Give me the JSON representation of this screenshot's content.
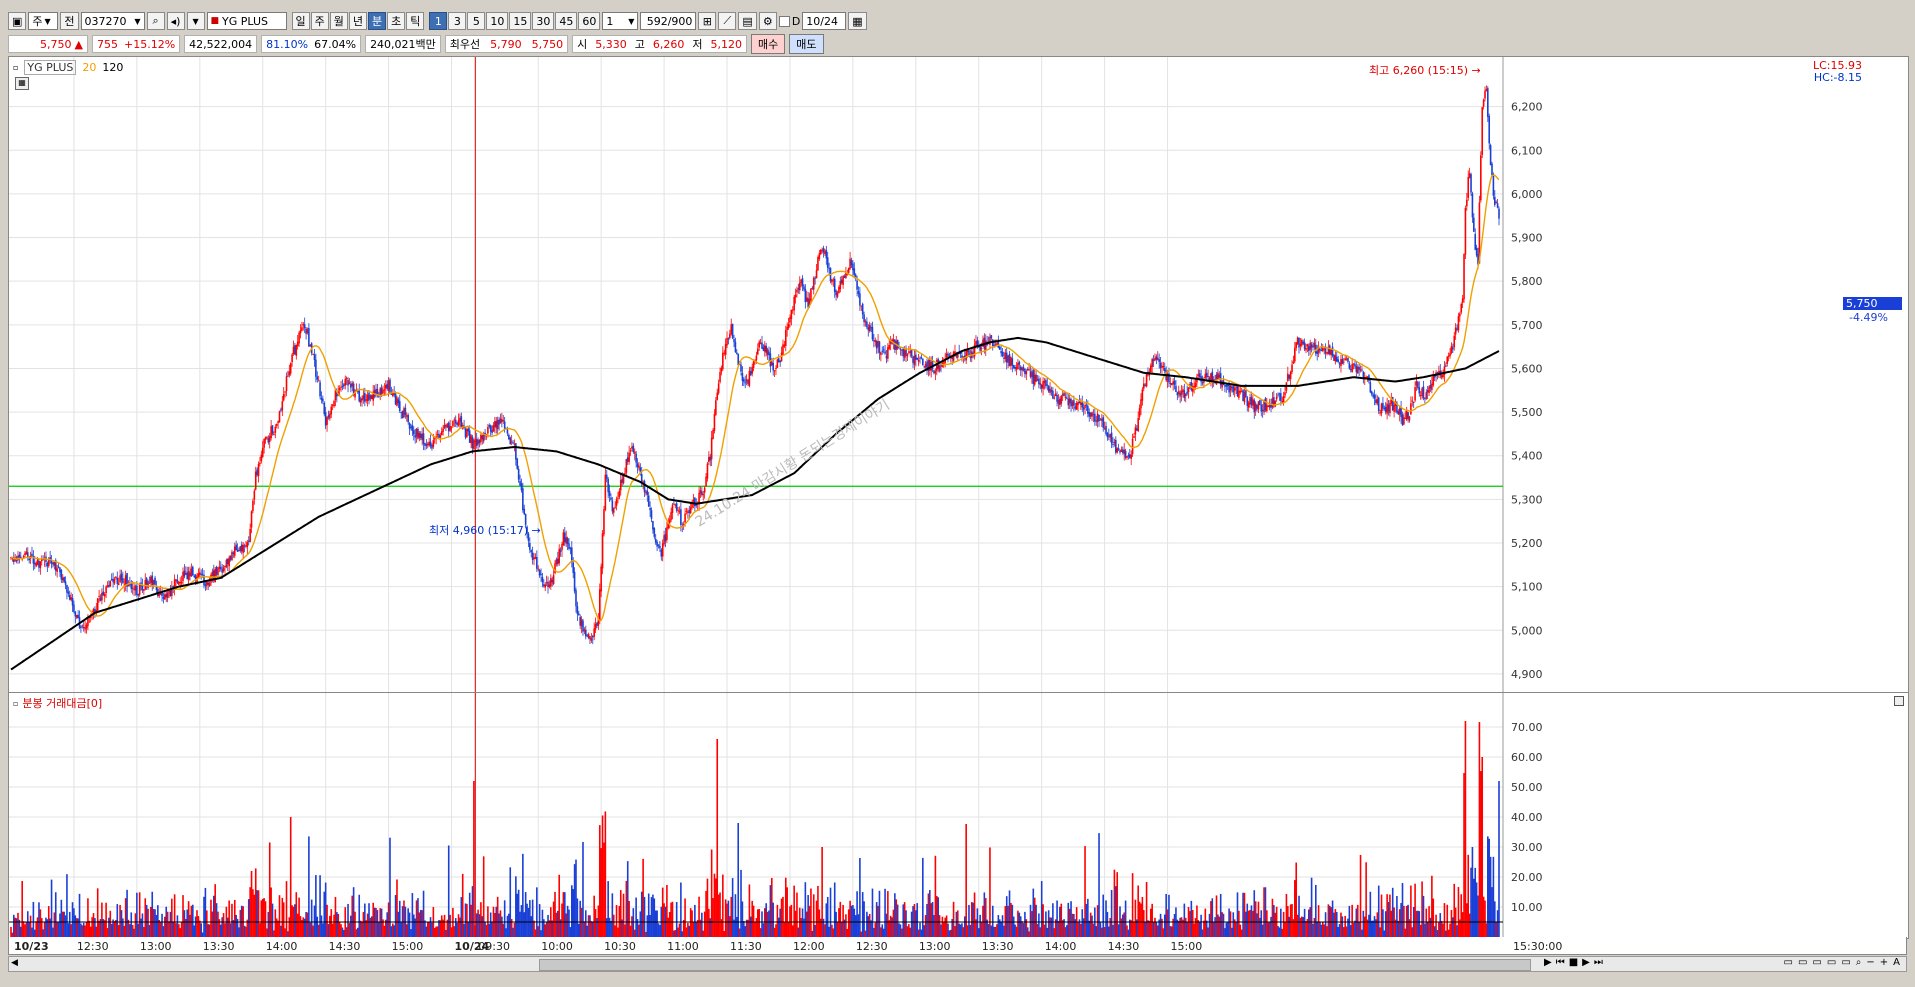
{
  "toolbar": {
    "period_type": "주",
    "prefix": "전",
    "code": "037270",
    "stock_name": "YG PLUS",
    "periods": [
      "일",
      "주",
      "월",
      "년",
      "분",
      "초",
      "틱"
    ],
    "period_selected": "분",
    "intervals": [
      "1",
      "3",
      "5",
      "10",
      "15",
      "30",
      "45",
      "60"
    ],
    "interval_selected": "1",
    "count_select": "1",
    "count_display": "592/900",
    "checkbox_label": "D",
    "date": "10/24"
  },
  "quote": {
    "price": "5,750",
    "change": "755",
    "change_pct": "+15.12%",
    "volume": "42,522,004",
    "ratio1": "81.10%",
    "ratio2": "67.04%",
    "amount": "240,021백만",
    "best_label": "최우선",
    "best_sell": "5,790",
    "best_buy": "5,750",
    "open_label": "시",
    "open": "5,330",
    "high_label": "고",
    "high": "6,260",
    "low_label": "저",
    "low": "5,120",
    "buy_btn": "매수",
    "sell_btn": "매도"
  },
  "chart_header": {
    "name": "YG PLUS",
    "ma_short": "20",
    "ma_long": "120",
    "lc": "LC:15.93",
    "hc": "HC:-8.15",
    "current_price": "5,750",
    "current_pct": "-4.49%",
    "high_annot": "최고 6,260 (15:15)",
    "low_annot": "최저 4,960 (15:17)",
    "watermark": "24.10.24 마감시황 돈되는경제이야기"
  },
  "volume_header": {
    "title": "분봉 거래대금[0]"
  },
  "colors": {
    "up": "#ff0000",
    "down": "#1a3fd6",
    "ma20": "#f0a000",
    "ma120": "#000000",
    "hline": "#00cc00"
  },
  "chart_data": {
    "type": "candlestick",
    "y_ticks": [
      "6,200",
      "6,100",
      "6,000",
      "5,900",
      "5,800",
      "5,700",
      "5,600",
      "5,500",
      "5,400",
      "5,300",
      "5,200",
      "5,100",
      "5,000",
      "4,900"
    ],
    "ylim": [
      4870,
      6300
    ],
    "horizontal_line": 5330,
    "vol_ticks": [
      "70.00",
      "60.00",
      "50.00",
      "40.00",
      "30.00",
      "20.00",
      "10.00"
    ],
    "vol_ylim": [
      0,
      78
    ],
    "x_labels": [
      "10/23",
      "12:30",
      "13:00",
      "13:30",
      "14:00",
      "14:30",
      "15:00",
      "10/24",
      "09:30",
      "10:00",
      "10:30",
      "11:00",
      "11:30",
      "12:00",
      "12:30",
      "13:00",
      "13:30",
      "14:00",
      "14:30",
      "15:00",
      "15:30:00"
    ],
    "price_anchors": [
      [
        0,
        5160
      ],
      [
        10,
        5180
      ],
      [
        20,
        5150
      ],
      [
        30,
        5160
      ],
      [
        40,
        5100
      ],
      [
        50,
        5000
      ],
      [
        60,
        5050
      ],
      [
        70,
        5110
      ],
      [
        80,
        5120
      ],
      [
        90,
        5090
      ],
      [
        100,
        5110
      ],
      [
        110,
        5070
      ],
      [
        120,
        5120
      ],
      [
        130,
        5130
      ],
      [
        140,
        5110
      ],
      [
        150,
        5140
      ],
      [
        160,
        5180
      ],
      [
        170,
        5200
      ],
      [
        175,
        5350
      ],
      [
        180,
        5420
      ],
      [
        185,
        5450
      ],
      [
        190,
        5470
      ],
      [
        200,
        5620
      ],
      [
        210,
        5700
      ],
      [
        215,
        5640
      ],
      [
        220,
        5560
      ],
      [
        225,
        5480
      ],
      [
        230,
        5530
      ],
      [
        240,
        5570
      ],
      [
        250,
        5530
      ],
      [
        260,
        5540
      ],
      [
        270,
        5560
      ],
      [
        280,
        5500
      ],
      [
        290,
        5450
      ],
      [
        300,
        5420
      ],
      [
        310,
        5460
      ],
      [
        320,
        5480
      ],
      [
        330,
        5430
      ],
      [
        340,
        5450
      ],
      [
        350,
        5480
      ],
      [
        360,
        5420
      ],
      [
        370,
        5200
      ],
      [
        380,
        5110
      ],
      [
        385,
        5100
      ],
      [
        390,
        5150
      ],
      [
        395,
        5220
      ],
      [
        400,
        5180
      ],
      [
        405,
        5030
      ],
      [
        410,
        5000
      ],
      [
        415,
        4990
      ],
      [
        420,
        5020
      ],
      [
        425,
        5350
      ],
      [
        430,
        5280
      ],
      [
        435,
        5320
      ],
      [
        440,
        5380
      ],
      [
        445,
        5420
      ],
      [
        450,
        5360
      ],
      [
        455,
        5300
      ],
      [
        460,
        5220
      ],
      [
        465,
        5180
      ],
      [
        470,
        5240
      ],
      [
        475,
        5300
      ],
      [
        480,
        5240
      ],
      [
        485,
        5280
      ],
      [
        490,
        5300
      ],
      [
        495,
        5320
      ],
      [
        500,
        5400
      ],
      [
        505,
        5550
      ],
      [
        510,
        5650
      ],
      [
        515,
        5690
      ],
      [
        520,
        5620
      ],
      [
        525,
        5560
      ],
      [
        530,
        5600
      ],
      [
        535,
        5660
      ],
      [
        540,
        5640
      ],
      [
        545,
        5600
      ],
      [
        550,
        5620
      ],
      [
        555,
        5700
      ],
      [
        560,
        5760
      ],
      [
        565,
        5800
      ],
      [
        570,
        5740
      ],
      [
        575,
        5820
      ],
      [
        580,
        5880
      ],
      [
        585,
        5820
      ],
      [
        590,
        5780
      ],
      [
        595,
        5800
      ],
      [
        600,
        5840
      ],
      [
        605,
        5780
      ],
      [
        610,
        5720
      ],
      [
        615,
        5680
      ],
      [
        620,
        5650
      ],
      [
        625,
        5630
      ],
      [
        630,
        5660
      ],
      [
        640,
        5630
      ],
      [
        650,
        5620
      ],
      [
        660,
        5600
      ],
      [
        670,
        5640
      ],
      [
        680,
        5620
      ],
      [
        690,
        5650
      ],
      [
        700,
        5660
      ],
      [
        710,
        5630
      ],
      [
        720,
        5600
      ],
      [
        730,
        5580
      ],
      [
        740,
        5560
      ],
      [
        750,
        5530
      ],
      [
        760,
        5520
      ],
      [
        770,
        5500
      ],
      [
        780,
        5480
      ],
      [
        790,
        5420
      ],
      [
        800,
        5400
      ],
      [
        805,
        5470
      ],
      [
        810,
        5560
      ],
      [
        815,
        5610
      ],
      [
        820,
        5620
      ],
      [
        830,
        5560
      ],
      [
        840,
        5540
      ],
      [
        850,
        5580
      ],
      [
        860,
        5580
      ],
      [
        870,
        5560
      ],
      [
        880,
        5540
      ],
      [
        890,
        5510
      ],
      [
        900,
        5520
      ],
      [
        910,
        5540
      ],
      [
        915,
        5600
      ],
      [
        920,
        5660
      ],
      [
        930,
        5650
      ],
      [
        940,
        5640
      ],
      [
        950,
        5620
      ],
      [
        960,
        5600
      ],
      [
        970,
        5580
      ],
      [
        975,
        5520
      ],
      [
        980,
        5510
      ],
      [
        990,
        5520
      ],
      [
        995,
        5480
      ],
      [
        1000,
        5500
      ],
      [
        1005,
        5560
      ],
      [
        1010,
        5540
      ],
      [
        1015,
        5560
      ],
      [
        1020,
        5590
      ],
      [
        1025,
        5600
      ],
      [
        1030,
        5640
      ],
      [
        1035,
        5720
      ],
      [
        1038,
        5760
      ],
      [
        1040,
        5960
      ],
      [
        1043,
        6060
      ],
      [
        1046,
        5900
      ],
      [
        1049,
        5850
      ],
      [
        1052,
        6200
      ],
      [
        1055,
        6250
      ],
      [
        1058,
        6060
      ],
      [
        1061,
        5980
      ],
      [
        1064,
        5950
      ]
    ],
    "ma120_anchors": [
      [
        0,
        4910
      ],
      [
        60,
        5040
      ],
      [
        120,
        5100
      ],
      [
        150,
        5120
      ],
      [
        180,
        5180
      ],
      [
        220,
        5260
      ],
      [
        260,
        5320
      ],
      [
        300,
        5380
      ],
      [
        330,
        5410
      ],
      [
        360,
        5420
      ],
      [
        390,
        5410
      ],
      [
        420,
        5380
      ],
      [
        450,
        5340
      ],
      [
        470,
        5300
      ],
      [
        490,
        5290
      ],
      [
        530,
        5310
      ],
      [
        560,
        5360
      ],
      [
        590,
        5450
      ],
      [
        620,
        5530
      ],
      [
        650,
        5590
      ],
      [
        680,
        5640
      ],
      [
        700,
        5660
      ],
      [
        720,
        5670
      ],
      [
        740,
        5660
      ],
      [
        760,
        5640
      ],
      [
        790,
        5610
      ],
      [
        810,
        5590
      ],
      [
        840,
        5580
      ],
      [
        880,
        5560
      ],
      [
        920,
        5560
      ],
      [
        960,
        5580
      ],
      [
        990,
        5570
      ],
      [
        1010,
        5580
      ],
      [
        1040,
        5600
      ],
      [
        1064,
        5640
      ]
    ]
  }
}
